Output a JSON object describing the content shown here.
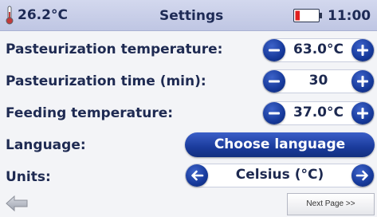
{
  "header": {
    "temperature": "26.2°C",
    "title": "Settings",
    "time": "11:00",
    "thermometer_icon": "thermometer-icon",
    "battery_icon": "battery-low-icon",
    "battery_level": 0.2
  },
  "settings": {
    "pasteurization_temperature": {
      "label": "Pasteurization temperature:",
      "value": "63.0°C"
    },
    "pasteurization_time": {
      "label": "Pasteurization time (min):",
      "value": "30"
    },
    "feeding_temperature": {
      "label": "Feeding temperature:",
      "value": "37.0°C"
    },
    "language": {
      "label": "Language:",
      "button": "Choose language"
    },
    "units": {
      "label": "Units:",
      "value": "Celsius (°C)"
    }
  },
  "footer": {
    "back_icon": "back-arrow-icon",
    "next_page": "Next Page >>"
  },
  "colors": {
    "header_bg": "#c6cce8",
    "accent_blue": "#1a3b9c",
    "text": "#1e2a52",
    "battery_red": "#e02020"
  }
}
